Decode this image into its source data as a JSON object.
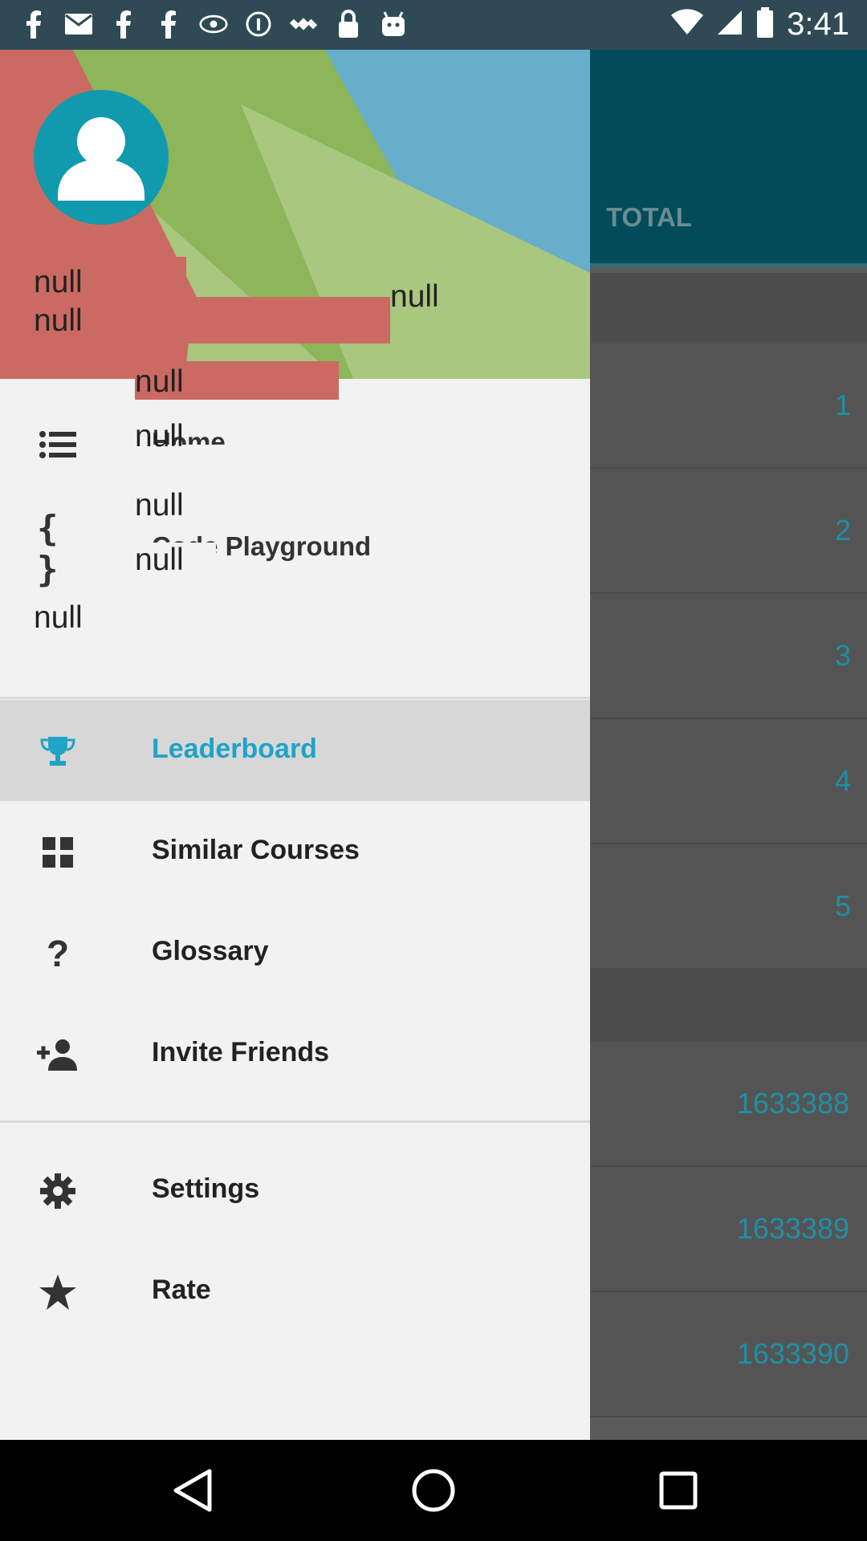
{
  "status_bar": {
    "time": "3:41",
    "left_icons": [
      "facebook-icon",
      "mail-icon",
      "facebook-icon",
      "facebook-icon",
      "eye-icon",
      "info-icon",
      "satellite-icon",
      "lock-icon",
      "android-icon"
    ],
    "right_icons": [
      "wifi-icon",
      "signal-icon",
      "battery-icon"
    ]
  },
  "background": {
    "tab_label": "TOTAL",
    "ranks": [
      "1",
      "2",
      "3",
      "4",
      "5"
    ],
    "ids": [
      "1633388",
      "1633389",
      "1633390"
    ]
  },
  "drawer": {
    "header": {
      "name_line1": "null",
      "name_line2": "null",
      "right_null": "null"
    },
    "overlap": {
      "null_a": "null",
      "null_b": "null",
      "null_c": "null",
      "null_d": "null",
      "null_e": "null",
      "home_label": "Home",
      "playground_label": "Code Playground"
    },
    "items": [
      {
        "label": "Leaderboard",
        "icon": "trophy-icon",
        "active": true
      },
      {
        "label": "Similar Courses",
        "icon": "grid-icon",
        "active": false
      },
      {
        "label": "Glossary",
        "icon": "question-icon",
        "active": false
      },
      {
        "label": "Invite Friends",
        "icon": "person-add-icon",
        "active": false
      },
      {
        "label": "Settings",
        "icon": "gear-icon",
        "active": false
      },
      {
        "label": "Rate",
        "icon": "star-icon",
        "active": false
      }
    ]
  },
  "colors": {
    "accent": "#1fa3c8",
    "toolbar": "#024b5a",
    "avatar": "#119aae",
    "header_red": "#cb6a63",
    "header_green": "#8db55a",
    "header_blue": "#67aeca"
  }
}
